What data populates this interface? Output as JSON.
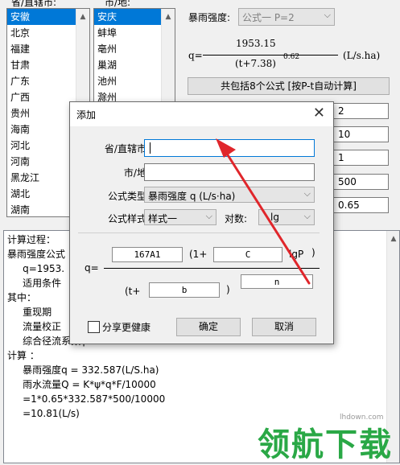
{
  "left_list": {
    "header": "省/直辖市:",
    "items": [
      "安徽",
      "北京",
      "福建",
      "甘肃",
      "广东",
      "广西",
      "贵州",
      "海南",
      "河北",
      "河南",
      "黑龙江",
      "湖北",
      "湖南"
    ],
    "selected": 0
  },
  "right_list": {
    "header": "市/地:",
    "items": [
      "安庆",
      "蚌埠",
      "亳州",
      "巢湖",
      "池州",
      "滁州"
    ],
    "selected": 0
  },
  "main": {
    "intensity_label": "暴雨强度:",
    "formula_combo": "公式一 P=2",
    "formula_q": "q=",
    "numerator": "1953.15",
    "denominator": "(t+7.38)",
    "exponent": "0.62",
    "unit": "(L/s.ha)",
    "count_button": "共包括8个公式 [按P-t自动计算]",
    "values": [
      "2",
      "10",
      "1",
      "500",
      "0.65"
    ]
  },
  "calc": {
    "lines": [
      "计算过程：",
      "暴雨强度公式",
      "     q=1953.",
      "     适用条件",
      "其中：",
      "     重现期",
      "     流量校正",
      "     综合径流系数ψ = 0.65",
      "计算 ：",
      "     暴雨强度q = 332.587(L/S.ha)",
      "     雨水流量Q = K*ψ*q*F/10000",
      "     =1*0.65*332.587*500/10000",
      "     =10.81(L/s)"
    ]
  },
  "dialog": {
    "title": "添加",
    "province_label": "省/直辖市:",
    "province_value": "",
    "city_label": "市/地:",
    "city_value": "",
    "type_label": "公式类型:",
    "type_value": "暴雨强度 q (L/s·ha)",
    "style_label": "公式样式:",
    "style_value": "样式一",
    "log_label": "对数:",
    "log_value": "lg",
    "q_label": "q=",
    "box_a": "167A1",
    "one_plus": "(1+",
    "box_c": "C",
    "lgP": "lgP",
    "close_paren": ")",
    "t_plus": "(t+",
    "box_b": "b",
    "close_paren2": ")",
    "box_n": "n",
    "share_label": "分享更健康",
    "ok": "确定",
    "cancel": "取消"
  },
  "watermark": {
    "text": "领航下载",
    "site": "lhdown.com"
  },
  "colors": {
    "selection": "#0078d7",
    "arrow": "#e0262b",
    "watermark": "#2aa846"
  }
}
